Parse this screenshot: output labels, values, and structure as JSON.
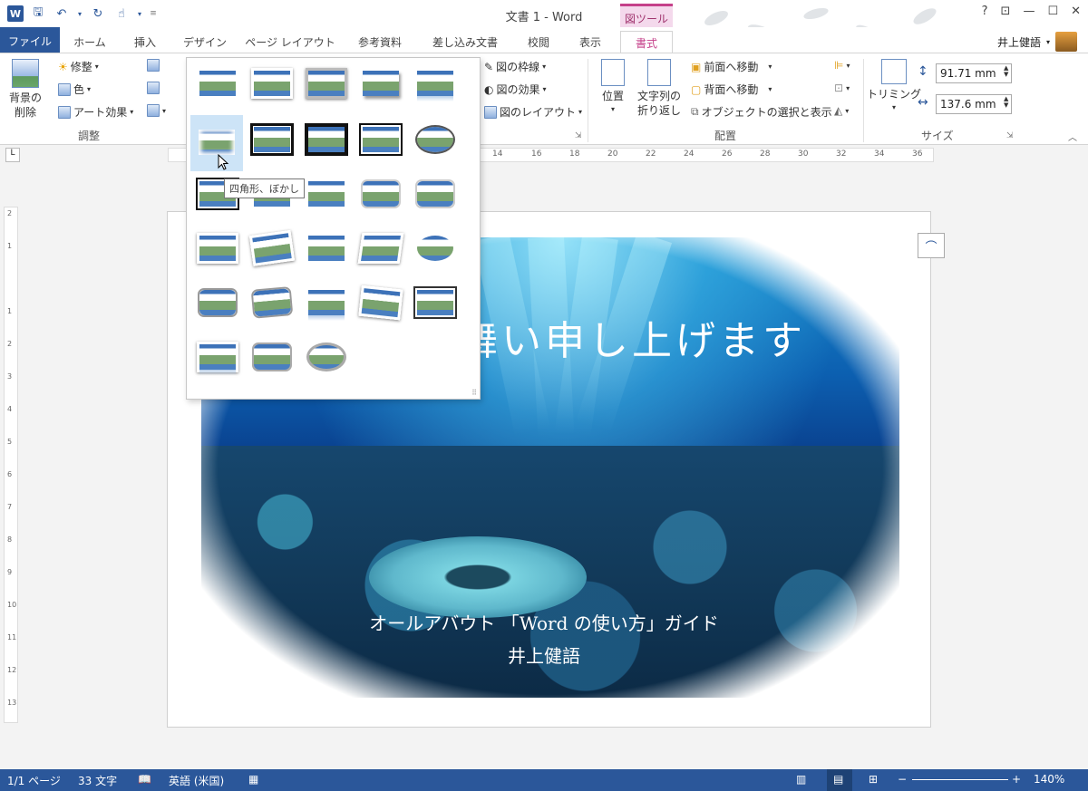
{
  "window": {
    "title": "文書 1 - Word",
    "contextual_tab_group": "図ツール",
    "user_name": "井上健語",
    "buttons": {
      "help": "?",
      "restore_ribbon": "⊡",
      "minimize": "—",
      "maximize": "☐",
      "close": "✕"
    }
  },
  "tabs": [
    {
      "label": "ファイル"
    },
    {
      "label": "ホーム"
    },
    {
      "label": "挿入"
    },
    {
      "label": "デザイン"
    },
    {
      "label": "ページ レイアウト"
    },
    {
      "label": "参考資料"
    },
    {
      "label": "差し込み文書"
    },
    {
      "label": "校閲"
    },
    {
      "label": "表示"
    },
    {
      "label": "書式"
    }
  ],
  "ribbon": {
    "adjust": {
      "remove_bg": "背景の",
      "remove_bg2": "削除",
      "corrections": "修整",
      "color": "色",
      "artistic": "アート効果",
      "group_label": "調整"
    },
    "styles": {
      "border": "図の枠線",
      "effects": "図の効果",
      "layout": "図のレイアウト"
    },
    "arrange": {
      "position": "位置",
      "wrap1": "文字列の",
      "wrap2": "折り返し",
      "bring_forward": "前面へ移動",
      "send_backward": "背面へ移動",
      "selection_pane": "オブジェクトの選択と表示",
      "group_label": "配置"
    },
    "size": {
      "crop": "トリミング",
      "height": "91.71 mm",
      "width": "137.6 mm",
      "group_label": "サイズ"
    }
  },
  "ruler": {
    "numbers": [
      "14",
      "16",
      "18",
      "20",
      "22",
      "24",
      "26",
      "28",
      "30",
      "32",
      "34",
      "36"
    ],
    "vertical": [
      "2",
      "1",
      "1",
      "2",
      "3",
      "4",
      "5",
      "6",
      "7",
      "8",
      "9",
      "10",
      "11",
      "12",
      "13"
    ]
  },
  "gallery": {
    "tooltip": "四角形、ぼかし",
    "hovered_index": 5
  },
  "document": {
    "heading": "舞い申し上げます",
    "line1": "オールアバウト 「Word の使い方」ガイド",
    "line2": "井上健語"
  },
  "status": {
    "page": "1/1 ページ",
    "words": "33 文字",
    "language": "英語 (米国)",
    "zoom": "140%",
    "zoom_minus": "−",
    "zoom_plus": "+",
    "zoom_level": 0.52
  }
}
